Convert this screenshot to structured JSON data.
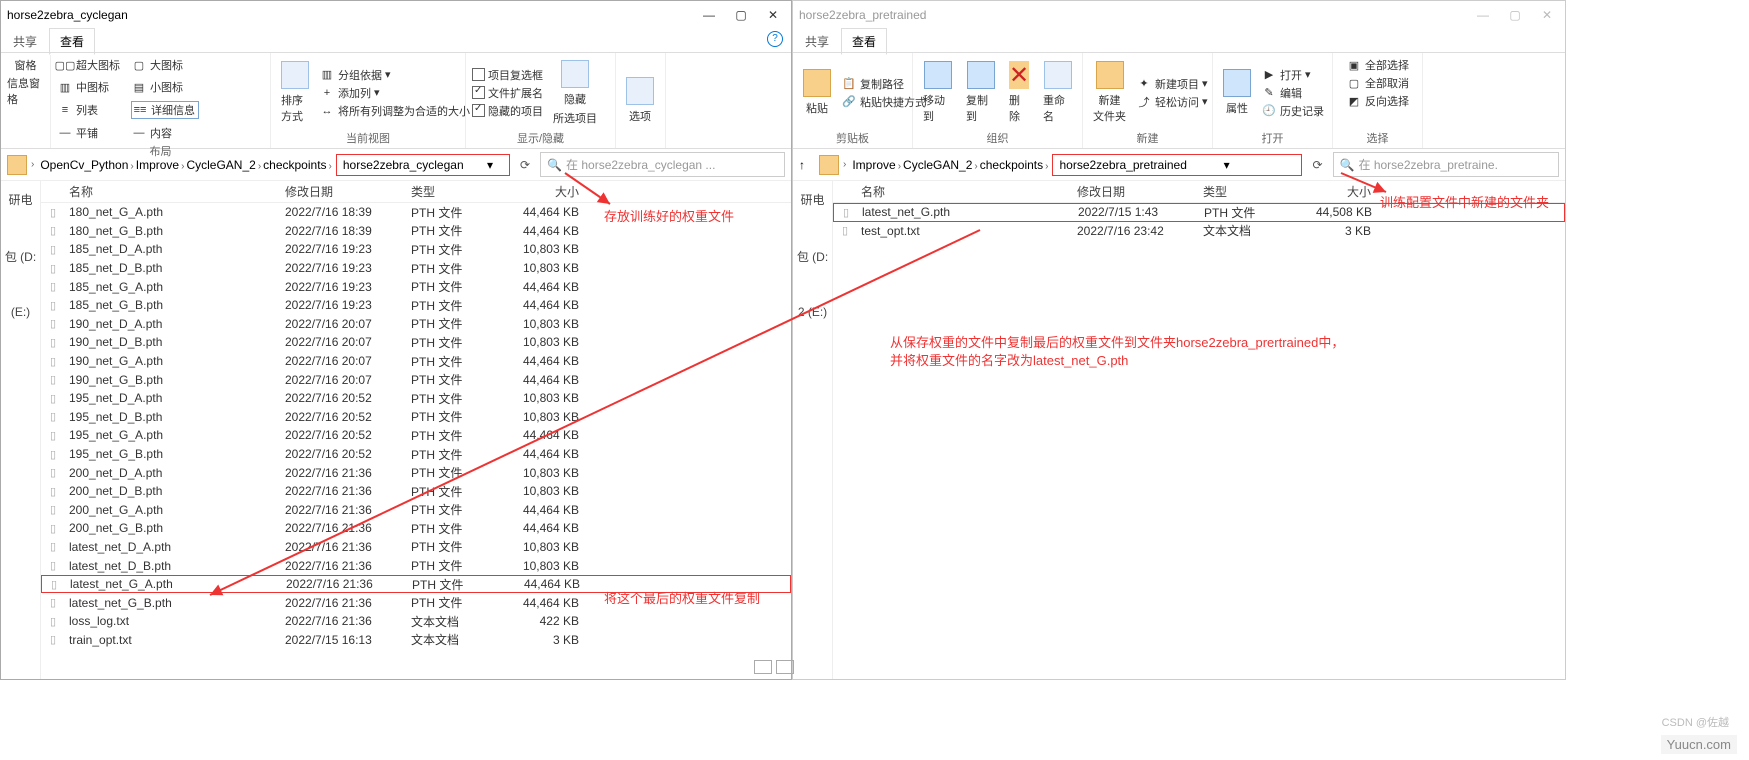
{
  "left": {
    "title": "horse2zebra_cyclegan",
    "tabs": [
      "共享",
      "查看"
    ],
    "ribbon": {
      "pane": {
        "items": [
          "窗格",
          "信息窗格"
        ],
        "label": ""
      },
      "layout": {
        "items": [
          {
            "icon": "▢▢",
            "text": "超大图标"
          },
          {
            "icon": "▢",
            "text": "大图标"
          },
          {
            "icon": "▥",
            "text": "中图标"
          },
          {
            "icon": "▤",
            "text": "小图标"
          },
          {
            "icon": "≡",
            "text": "列表"
          },
          {
            "icon": "≡≡",
            "text": "详细信息",
            "active": true
          },
          {
            "icon": "—",
            "text": "平铺"
          },
          {
            "icon": "—",
            "text": "内容"
          }
        ],
        "label": "布局"
      },
      "view": {
        "sort": "排序方式",
        "group": "分组依据",
        "add": "添加列",
        "fit": "将所有列调整为合适的大小",
        "label": "当前视图"
      },
      "showhide": {
        "cb1": "项目复选框",
        "cb2": "文件扩展名",
        "cb3": "隐藏的项目",
        "hide": "隐藏",
        "selected": "所选项目",
        "label": "显示/隐藏"
      },
      "options": "选项"
    },
    "breadcrumb": [
      "OpenCv_Python",
      "Improve",
      "CycleGAN_2",
      "checkpoints"
    ],
    "address": "horse2zebra_cyclegan",
    "search_ph": "在 horse2zebra_cyclegan ...",
    "columns": [
      "名称",
      "修改日期",
      "类型",
      "大小"
    ],
    "files": [
      {
        "n": "180_net_G_A.pth",
        "d": "2022/7/16 18:39",
        "t": "PTH 文件",
        "s": "44,464 KB"
      },
      {
        "n": "180_net_G_B.pth",
        "d": "2022/7/16 18:39",
        "t": "PTH 文件",
        "s": "44,464 KB"
      },
      {
        "n": "185_net_D_A.pth",
        "d": "2022/7/16 19:23",
        "t": "PTH 文件",
        "s": "10,803 KB"
      },
      {
        "n": "185_net_D_B.pth",
        "d": "2022/7/16 19:23",
        "t": "PTH 文件",
        "s": "10,803 KB"
      },
      {
        "n": "185_net_G_A.pth",
        "d": "2022/7/16 19:23",
        "t": "PTH 文件",
        "s": "44,464 KB"
      },
      {
        "n": "185_net_G_B.pth",
        "d": "2022/7/16 19:23",
        "t": "PTH 文件",
        "s": "44,464 KB"
      },
      {
        "n": "190_net_D_A.pth",
        "d": "2022/7/16 20:07",
        "t": "PTH 文件",
        "s": "10,803 KB"
      },
      {
        "n": "190_net_D_B.pth",
        "d": "2022/7/16 20:07",
        "t": "PTH 文件",
        "s": "10,803 KB"
      },
      {
        "n": "190_net_G_A.pth",
        "d": "2022/7/16 20:07",
        "t": "PTH 文件",
        "s": "44,464 KB"
      },
      {
        "n": "190_net_G_B.pth",
        "d": "2022/7/16 20:07",
        "t": "PTH 文件",
        "s": "44,464 KB"
      },
      {
        "n": "195_net_D_A.pth",
        "d": "2022/7/16 20:52",
        "t": "PTH 文件",
        "s": "10,803 KB"
      },
      {
        "n": "195_net_D_B.pth",
        "d": "2022/7/16 20:52",
        "t": "PTH 文件",
        "s": "10,803 KB"
      },
      {
        "n": "195_net_G_A.pth",
        "d": "2022/7/16 20:52",
        "t": "PTH 文件",
        "s": "44,464 KB"
      },
      {
        "n": "195_net_G_B.pth",
        "d": "2022/7/16 20:52",
        "t": "PTH 文件",
        "s": "44,464 KB"
      },
      {
        "n": "200_net_D_A.pth",
        "d": "2022/7/16 21:36",
        "t": "PTH 文件",
        "s": "10,803 KB"
      },
      {
        "n": "200_net_D_B.pth",
        "d": "2022/7/16 21:36",
        "t": "PTH 文件",
        "s": "10,803 KB"
      },
      {
        "n": "200_net_G_A.pth",
        "d": "2022/7/16 21:36",
        "t": "PTH 文件",
        "s": "44,464 KB"
      },
      {
        "n": "200_net_G_B.pth",
        "d": "2022/7/16 21:36",
        "t": "PTH 文件",
        "s": "44,464 KB"
      },
      {
        "n": "latest_net_D_A.pth",
        "d": "2022/7/16 21:36",
        "t": "PTH 文件",
        "s": "10,803 KB"
      },
      {
        "n": "latest_net_D_B.pth",
        "d": "2022/7/16 21:36",
        "t": "PTH 文件",
        "s": "10,803 KB"
      },
      {
        "n": "latest_net_G_A.pth",
        "d": "2022/7/16 21:36",
        "t": "PTH 文件",
        "s": "44,464 KB",
        "hl": true
      },
      {
        "n": "latest_net_G_B.pth",
        "d": "2022/7/16 21:36",
        "t": "PTH 文件",
        "s": "44,464 KB"
      },
      {
        "n": "loss_log.txt",
        "d": "2022/7/16 21:36",
        "t": "文本文档",
        "s": "422 KB"
      },
      {
        "n": "train_opt.txt",
        "d": "2022/7/15 16:13",
        "t": "文本文档",
        "s": "3 KB"
      }
    ],
    "side": [
      "研电",
      "包 (D:",
      "(E:)"
    ],
    "ann1": "存放训练好的权重文件",
    "ann2": "将这个最后的权重文件复制"
  },
  "right": {
    "title": "horse2zebra_pretrained",
    "tabs": [
      "共享",
      "查看"
    ],
    "ribbon": {
      "clipboard": {
        "paste": "粘贴",
        "copy_path": "复制路径",
        "paste_link": "粘贴快捷方式",
        "label": "剪贴板"
      },
      "org": {
        "move": "移动到",
        "copy": "复制到",
        "del": "删除",
        "rename": "重命名",
        "label": "组织"
      },
      "new": {
        "new_folder": "新建\n文件夹",
        "new_item": "新建项目",
        "easy": "轻松访问",
        "label": "新建"
      },
      "open": {
        "props": "属性",
        "open": "打开",
        "edit": "编辑",
        "hist": "历史记录",
        "label": "打开"
      },
      "select": {
        "all": "全部选择",
        "none": "全部取消",
        "inv": "反向选择",
        "label": "选择"
      }
    },
    "breadcrumb": [
      "Improve",
      "CycleGAN_2",
      "checkpoints"
    ],
    "address": "horse2zebra_pretrained",
    "search_ph": "在 horse2zebra_pretraine.",
    "columns": [
      "名称",
      "修改日期",
      "类型",
      "大小"
    ],
    "files": [
      {
        "n": "latest_net_G.pth",
        "d": "2022/7/15 1:43",
        "t": "PTH 文件",
        "s": "44,508 KB",
        "hl": true
      },
      {
        "n": "test_opt.txt",
        "d": "2022/7/16 23:42",
        "t": "文本文档",
        "s": "3 KB"
      }
    ],
    "side": [
      "研电",
      "包 (D:",
      "2 (E:)"
    ],
    "ann1": "训练配置文件中新建的文件夹",
    "ann2": "从保存权重的文件中复制最后的权重文件到文件夹horse2zebra_prertrained中，",
    "ann3": "并将权重文件的名字改为latest_net_G.pth"
  },
  "watermark": "Yuucn.com",
  "csdn": "CSDN @佐越",
  "help": "?"
}
